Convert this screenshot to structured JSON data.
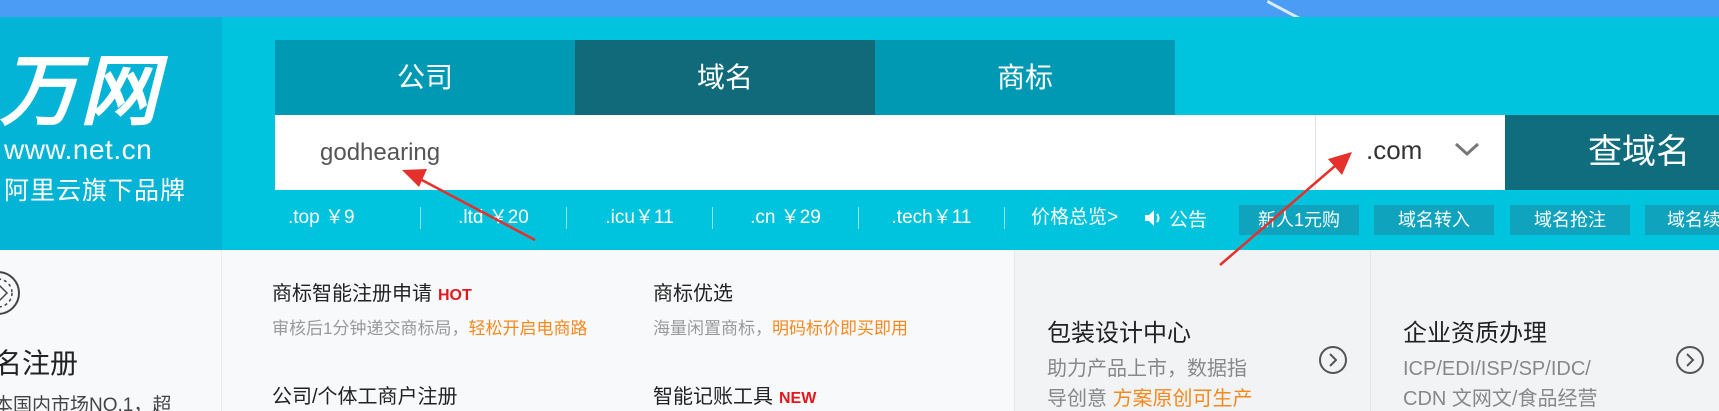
{
  "logo": {
    "brand": "万网",
    "url": "www.net.cn",
    "slogan": "阿里云旗下品牌"
  },
  "tabs": [
    {
      "label": "公司",
      "active": false
    },
    {
      "label": "域名",
      "active": true
    },
    {
      "label": "商标",
      "active": false
    }
  ],
  "search": {
    "value": "godhearing",
    "suffix": ".com",
    "button_label": "查域名"
  },
  "prices": [
    {
      "label": ".top ￥9"
    },
    {
      "label": ".ltd ￥20"
    },
    {
      "label": ".icu￥11"
    },
    {
      "label": ".cn ￥29"
    },
    {
      "label": ".tech￥11"
    }
  ],
  "price_overview": "价格总览>",
  "notice": "公告",
  "quick_links": [
    "新人1元购",
    "域名转入",
    "域名抢注",
    "域名续"
  ],
  "left_card": {
    "title": "名注册",
    "desc": "本国内市场NO.1，超"
  },
  "services": [
    {
      "title": "商标智能注册申请",
      "badge": "HOT",
      "desc": "审核后1分钟递交商标局，",
      "highlight": "轻松开启电商路"
    },
    {
      "title": "商标优选",
      "badge": "",
      "desc": "海量闲置商标，",
      "highlight": "明码标价即买即用"
    },
    {
      "title": "公司/个体工商户注册",
      "badge": "",
      "desc": "",
      "highlight": ""
    },
    {
      "title": "智能记账工具",
      "badge": "NEW",
      "desc": "",
      "highlight": ""
    }
  ],
  "pack_card": {
    "title": "包装设计中心",
    "desc_line1": "助力产品上市，数据指",
    "desc_line2_plain": "导创意 ",
    "desc_line2_highlight": "方案原创可生产"
  },
  "ent_card": {
    "title": "企业资质办理",
    "desc_line1": "ICP/EDI/ISP/SP/IDC/",
    "desc_line2": "CDN 文网文/食品经营"
  },
  "colors": {
    "banner": "#00c3dd",
    "active_tab": "#106a7a",
    "tab": "#0099b4",
    "highlight": "#f5891e",
    "badge": "#e5171c",
    "annotation_arrow": "#e5302b"
  }
}
